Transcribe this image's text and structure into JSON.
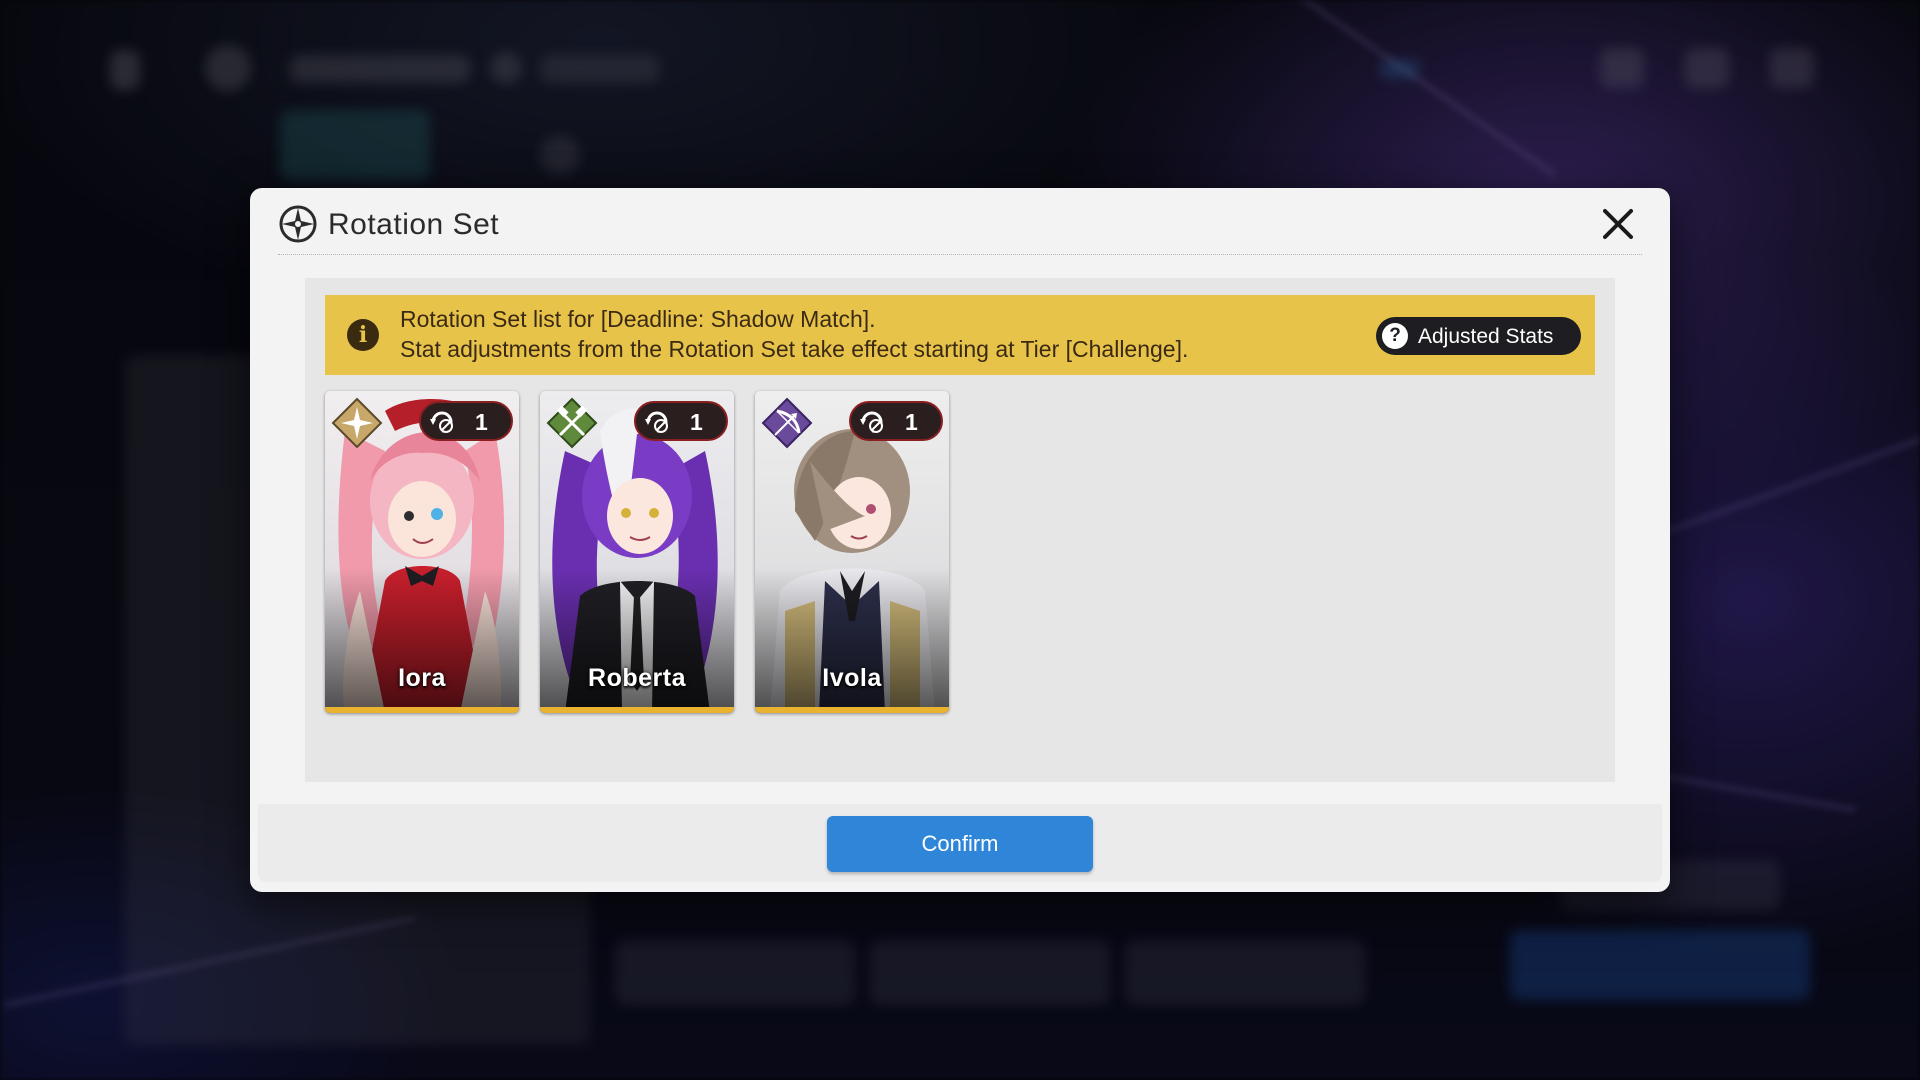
{
  "dialog": {
    "title": "Rotation Set",
    "notice": {
      "line1": "Rotation Set list for [Deadline: Shadow Match].",
      "line2": "Stat adjustments from the Rotation Set take effect starting at Tier [Challenge].",
      "adjust_button_label": "Adjusted Stats"
    },
    "cards": [
      {
        "name": "Iora",
        "count": "1",
        "class_icon": "support-star-icon",
        "class_color": "#c7a86a"
      },
      {
        "name": "Roberta",
        "count": "1",
        "class_icon": "crossed-hammers-icon",
        "class_color": "#5f8a3c"
      },
      {
        "name": "Ivola",
        "count": "1",
        "class_icon": "bow-icon",
        "class_color": "#6a4a9a"
      }
    ],
    "confirm_label": "Confirm"
  },
  "colors": {
    "accent": "#2f86d9",
    "notice_bg": "#e8c34a",
    "card_trim": "#e9b22f"
  }
}
